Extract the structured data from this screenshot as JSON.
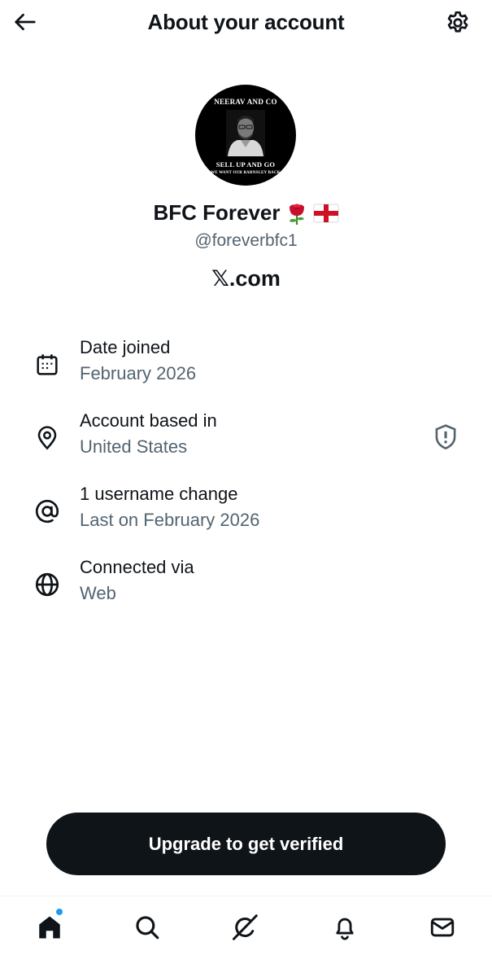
{
  "header": {
    "title": "About your account",
    "back_icon": "arrow-left-icon",
    "settings_icon": "gear-icon"
  },
  "profile": {
    "avatar_text_top": "NEERAV AND CO",
    "avatar_text_mid": "SELL UP AND GO",
    "avatar_text_bottom": "WE WANT OUR BARNSLEY BACK",
    "name": "BFC Forever",
    "name_emojis": [
      "rose",
      "england-flag"
    ],
    "handle": "@foreverbfc1",
    "site": "𝕏.com"
  },
  "info": [
    {
      "icon": "calendar-icon",
      "title": "Date joined",
      "subtitle": "February 2026"
    },
    {
      "icon": "location-pin-icon",
      "title": "Account based in",
      "subtitle": "United States",
      "trailing_icon": "shield-alert-icon"
    },
    {
      "icon": "at-sign-icon",
      "title": "1 username change",
      "subtitle": "Last on February 2026"
    },
    {
      "icon": "globe-icon",
      "title": "Connected via",
      "subtitle": "Web"
    }
  ],
  "cta": {
    "label": "Upgrade to get verified"
  },
  "bottom_nav": {
    "items": [
      "home-icon",
      "search-icon",
      "grok-icon",
      "notifications-icon",
      "messages-icon"
    ],
    "home_badge_color": "#1d9bf0"
  },
  "colors": {
    "text": "#0f1419",
    "secondary": "#536471",
    "button": "#0f1419"
  }
}
